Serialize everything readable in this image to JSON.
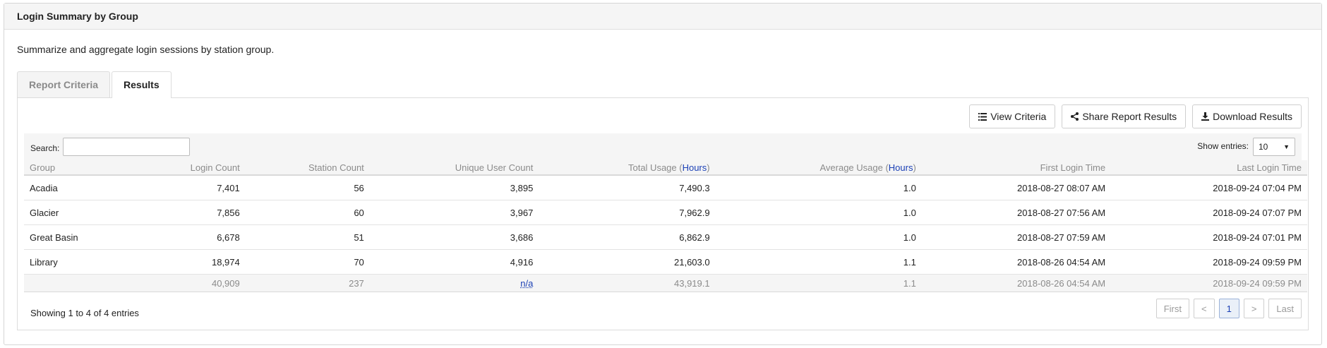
{
  "panel": {
    "title": "Login Summary by Group",
    "description": "Summarize and aggregate login sessions by station group."
  },
  "tabs": [
    {
      "label": "Report Criteria",
      "active": false
    },
    {
      "label": "Results",
      "active": true
    }
  ],
  "toolbar": {
    "view_criteria": "View Criteria",
    "share": "Share Report Results",
    "download": "Download Results"
  },
  "filters": {
    "search_label": "Search:",
    "search_value": "",
    "entries_label": "Show entries:",
    "entries_value": "10"
  },
  "table": {
    "columns": {
      "group": "Group",
      "login_count": "Login Count",
      "station_count": "Station Count",
      "unique_user_count": "Unique User Count",
      "total_usage": "Total Usage (",
      "average_usage": "Average Usage (",
      "hours_link": "Hours",
      "close_paren": ")",
      "first_login": "First Login Time",
      "last_login": "Last Login Time"
    },
    "rows": [
      {
        "group": "Acadia",
        "login_count": "7,401",
        "station_count": "56",
        "unique_user_count": "3,895",
        "total_usage": "7,490.3",
        "average_usage": "1.0",
        "first_login": "2018-08-27 08:07 AM",
        "last_login": "2018-09-24 07:04 PM"
      },
      {
        "group": "Glacier",
        "login_count": "7,856",
        "station_count": "60",
        "unique_user_count": "3,967",
        "total_usage": "7,962.9",
        "average_usage": "1.0",
        "first_login": "2018-08-27 07:56 AM",
        "last_login": "2018-09-24 07:07 PM"
      },
      {
        "group": "Great Basin",
        "login_count": "6,678",
        "station_count": "51",
        "unique_user_count": "3,686",
        "total_usage": "6,862.9",
        "average_usage": "1.0",
        "first_login": "2018-08-27 07:59 AM",
        "last_login": "2018-09-24 07:01 PM"
      },
      {
        "group": "Library",
        "login_count": "18,974",
        "station_count": "70",
        "unique_user_count": "4,916",
        "total_usage": "21,603.0",
        "average_usage": "1.1",
        "first_login": "2018-08-26 04:54 AM",
        "last_login": "2018-09-24 09:59 PM"
      }
    ],
    "totals": {
      "group": "",
      "login_count": "40,909",
      "station_count": "237",
      "unique_user_count": "n/a",
      "total_usage": "43,919.1",
      "average_usage": "1.1",
      "first_login": "2018-08-26 04:54 AM",
      "last_login": "2018-09-24 09:59 PM"
    }
  },
  "footer": {
    "info": "Showing 1 to 4 of 4 entries",
    "pager": {
      "first": "First",
      "prev": "<",
      "current": "1",
      "next": ">",
      "last": "Last"
    }
  },
  "icons": {
    "view_criteria": "list-icon",
    "share": "share-icon",
    "download": "download-icon",
    "entries_caret": "caret-down-icon"
  },
  "colors": {
    "link": "#1a3fb5",
    "header_bg": "#f5f5f5"
  }
}
